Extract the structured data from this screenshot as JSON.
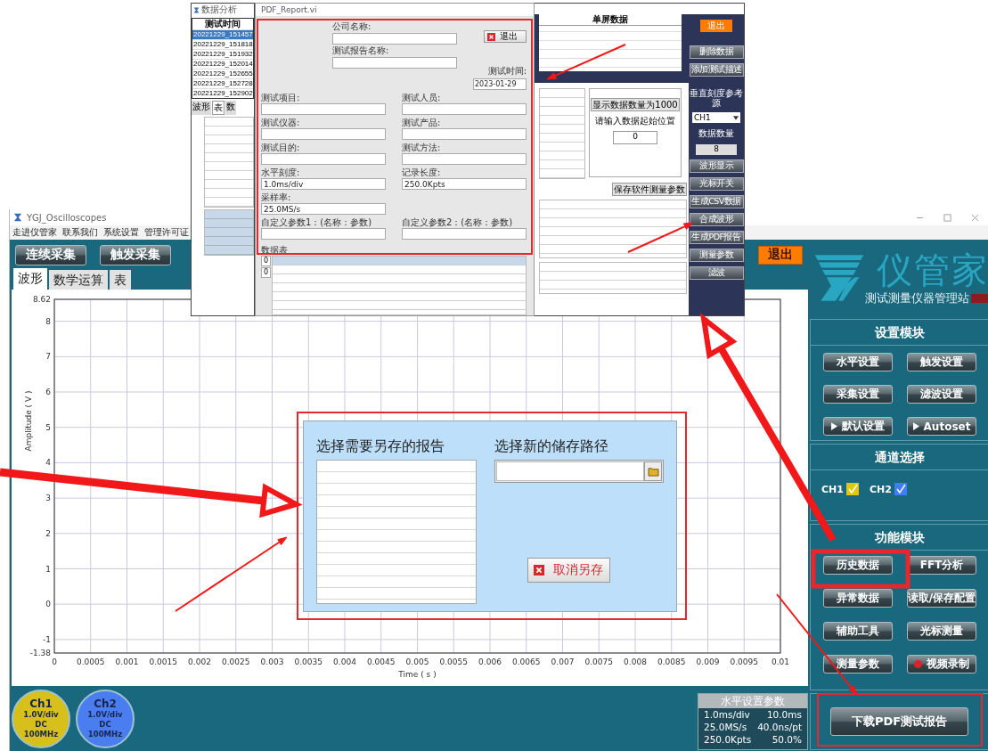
{
  "overlay": {
    "analysis_window": {
      "title": "数据分析",
      "list_header": "测试时间",
      "times": [
        {
          "text": "20221229_151457",
          "selected": true
        },
        {
          "text": "20221229_151818",
          "selected": false
        },
        {
          "text": "20221229_151932",
          "selected": false
        },
        {
          "text": "20221229_152014",
          "selected": false
        },
        {
          "text": "20221229_152655",
          "selected": false
        },
        {
          "text": "20221229_152728",
          "selected": false
        },
        {
          "text": "20221229_152902",
          "selected": false
        }
      ],
      "tabs": [
        {
          "label": "波形",
          "selected": false
        },
        {
          "label": "表",
          "selected": true
        },
        {
          "label": "数",
          "selected": false
        }
      ]
    },
    "report_window": {
      "title": "PDF_Report.vi",
      "company_label": "公司名称:",
      "report_name_label": "测试报告名称:",
      "exit_button": "退出",
      "date_label": "测试时间:",
      "date_value": "2023-01-29",
      "field_rows": [
        [
          {
            "label": "测试项目:"
          },
          {
            "label": "测试人员:"
          }
        ],
        [
          {
            "label": "测试仪器:"
          },
          {
            "label": "测试产品:"
          }
        ],
        [
          {
            "label": "测试目的:"
          },
          {
            "label": "测试方法:"
          }
        ],
        [
          {
            "label": "水平刻度:",
            "value": "1.0ms/div"
          },
          {
            "label": "记录长度:",
            "value": "250.0Kpts"
          }
        ],
        [
          {
            "label": "采样率:",
            "value": "25.0MS/s"
          }
        ],
        [
          {
            "label": "自定义参数1：(名称：参数)"
          },
          {
            "label": "自定义参数2：(名称：参数)"
          }
        ]
      ],
      "table_label": "数据表",
      "table_indexes": [
        "0",
        "0"
      ]
    },
    "data_window": {
      "single_screen_header": "单屏数据",
      "display_count_button": "显示数据数量为1000",
      "start_label": "请输入数据起始位置",
      "start_value": "0",
      "save_params_button": "保存软件测量参数",
      "exit_button": "退出",
      "top_buttons": [
        "删除数据",
        "添加测试描述"
      ],
      "ref_label": "垂直刻度参考源",
      "ref_value": "CH1",
      "count_label": "数据数量",
      "count_value": "8",
      "buttons": [
        "波形显示",
        "光标开关",
        "生成CSV数据",
        "合成波形",
        "生成PDF报告",
        "测量参数",
        "滤波"
      ]
    }
  },
  "main_window": {
    "title": "YGJ_Oscilloscopes",
    "menu": [
      "走进仪管家",
      "联系我们",
      "系统设置",
      "管理许可证"
    ],
    "toolbar": [
      "连续采集",
      "触发采集"
    ],
    "exit_button": "退出",
    "tabs": [
      {
        "label": "波形",
        "selected": true
      },
      {
        "label": "数学运算",
        "selected": false
      },
      {
        "label": "表",
        "selected": false
      }
    ],
    "chart": {
      "chart_data": {
        "type": "line",
        "grid": true,
        "xlabel": "Time ( s )",
        "ylabel": "Amplitude ( V )",
        "xlim": [
          0,
          0.01
        ],
        "ylim": [
          -1.38,
          8.62
        ],
        "xticks": [
          0,
          0.0005,
          0.001,
          0.0015,
          0.002,
          0.0025,
          0.003,
          0.0035,
          0.004,
          0.0045,
          0.005,
          0.0055,
          0.006,
          0.0065,
          0.007,
          0.0075,
          0.008,
          0.0085,
          0.009,
          0.0095,
          0.01
        ],
        "yticks": [
          -1.38,
          -1,
          0,
          1,
          2,
          3,
          4,
          5,
          6,
          7,
          8,
          8.62
        ]
      }
    },
    "dialog": {
      "reports_label": "选择需要另存的报告",
      "path_label": "选择新的储存路径",
      "cancel_button": "取消另存"
    },
    "channels": [
      {
        "name": "Ch1",
        "scale": "1.0V/div",
        "coupling": "DC",
        "bandwidth": "100MHz",
        "color": "#d8c01c"
      },
      {
        "name": "Ch2",
        "scale": "1.0V/div",
        "coupling": "DC",
        "bandwidth": "100MHz",
        "color": "#4a7df0"
      }
    ],
    "horizontal_params": {
      "title": "水平设置参数",
      "rows": [
        [
          "1.0ms/div",
          "10.0ms"
        ],
        [
          "25.0MS/s",
          "40.0ns/pt"
        ],
        [
          "250.0Kpts",
          "50.0%"
        ]
      ]
    },
    "right_panel": {
      "logo_text": "仪管家",
      "logo_subtitle": "测试测量仪器管理站",
      "settings": {
        "title": "设置模块",
        "buttons": [
          {
            "label": "水平设置",
            "kind": "plain"
          },
          {
            "label": "触发设置",
            "kind": "plain"
          },
          {
            "label": "采集设置",
            "kind": "plain"
          },
          {
            "label": "滤波设置",
            "kind": "plain"
          },
          {
            "label": "默认设置",
            "kind": "play"
          },
          {
            "label": "Autoset",
            "kind": "play"
          }
        ]
      },
      "channel_select": {
        "title": "通道选择",
        "channels": [
          {
            "label": "CH1",
            "checked": true,
            "color": "#e0c812"
          },
          {
            "label": "CH2",
            "checked": true,
            "color": "#3f7ef5"
          }
        ]
      },
      "functions": {
        "title": "功能模块",
        "buttons": [
          {
            "label": "历史数据",
            "kind": "plain"
          },
          {
            "label": "FFT分析",
            "kind": "plain"
          },
          {
            "label": "异常数据",
            "kind": "plain"
          },
          {
            "label": "读取/保存配置",
            "kind": "plain"
          },
          {
            "label": "辅助工具",
            "kind": "plain"
          },
          {
            "label": "光标测量",
            "kind": "plain"
          },
          {
            "label": "测量参数",
            "kind": "plain"
          },
          {
            "label": "视频录制",
            "kind": "record"
          }
        ]
      },
      "download_button": "下载PDF测试报告"
    }
  }
}
